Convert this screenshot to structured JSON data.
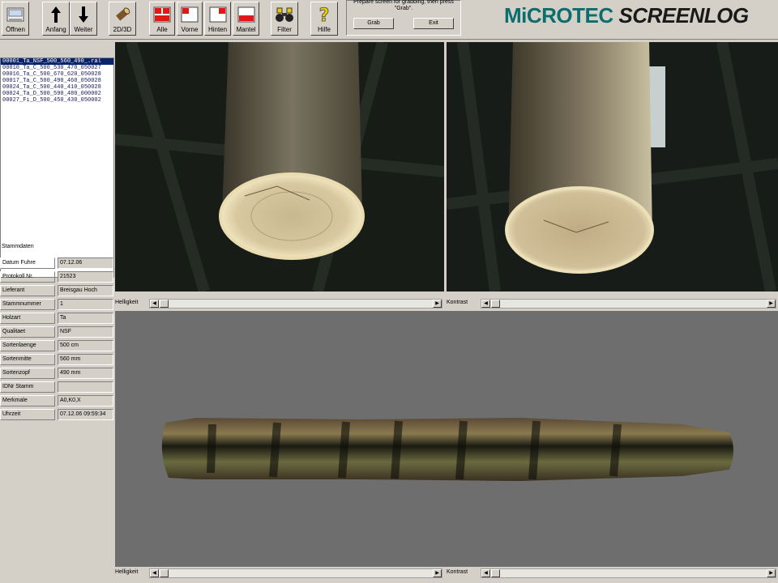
{
  "toolbar": {
    "buttons": [
      {
        "label": "Öffnen",
        "icon": "open-folder-icon"
      },
      {
        "label": "Anfang",
        "icon": "arrow-up-icon"
      },
      {
        "label": "Weiter",
        "icon": "arrow-down-icon"
      },
      {
        "label": "2D/3D",
        "icon": "log-icon"
      },
      {
        "label": "Alle",
        "icon": "all-views-icon"
      },
      {
        "label": "Vorne",
        "icon": "front-view-icon"
      },
      {
        "label": "Hinten",
        "icon": "back-view-icon"
      },
      {
        "label": "Mantel",
        "icon": "mantle-view-icon"
      },
      {
        "label": "Filter",
        "icon": "binoculars-icon"
      },
      {
        "label": "Hilfe",
        "icon": "help-icon"
      }
    ],
    "grab": {
      "message": "Prepare screen for grabbing, then press \"Grab\".",
      "grab_label": "Grab",
      "exit_label": "Exit"
    }
  },
  "brand": {
    "part1": "MiCROTEC",
    "part2": "SCREENLOG"
  },
  "file_list": [
    "00001_Ta_NSF_500_560_490_.ral",
    "00010_Ta_C_500_530_470_050027",
    "00016_Ta_C_500_670_620_050028",
    "00017_Ta_C_500_490_460_050028",
    "00024_Ta_C_500_440_410_050028",
    "00024_Ta_D_500_590_480_000002",
    "00027_Fi_D_500_450_430_050002"
  ],
  "selected_file_index": 0,
  "stammdaten": {
    "title": "Stammdaten",
    "rows": [
      {
        "label": "Datum Fuhre",
        "value": "07.12.06"
      },
      {
        "label": "Protokoll Nr.",
        "value": "21523"
      },
      {
        "label": "Lieferant",
        "value": "Breisgau Hoch"
      },
      {
        "label": "Stammnummer",
        "value": "1"
      },
      {
        "label": "Holzart",
        "value": "Ta"
      },
      {
        "label": "Qualitaet",
        "value": "NSF"
      },
      {
        "label": "Sortenlaenge",
        "value": "500 cm"
      },
      {
        "label": "Sortenmitte",
        "value": "560 mm"
      },
      {
        "label": "Sortenzopf",
        "value": "490 mm"
      },
      {
        "label": "IDNr Stamm",
        "value": ""
      },
      {
        "label": "Merkmale",
        "value": "A0,K0,X"
      },
      {
        "label": "Uhrzeit",
        "value": "07.12.06 09:59:34"
      }
    ]
  },
  "views": {
    "helligkeit_label": "Helligkeit",
    "kontrast_label": "Kontrast"
  },
  "colors": {
    "window_bg": "#d4d0c8",
    "selection": "#0a246a",
    "view3d_bg": "#6e6e6e",
    "brand_accent": "#0a6e6e"
  }
}
